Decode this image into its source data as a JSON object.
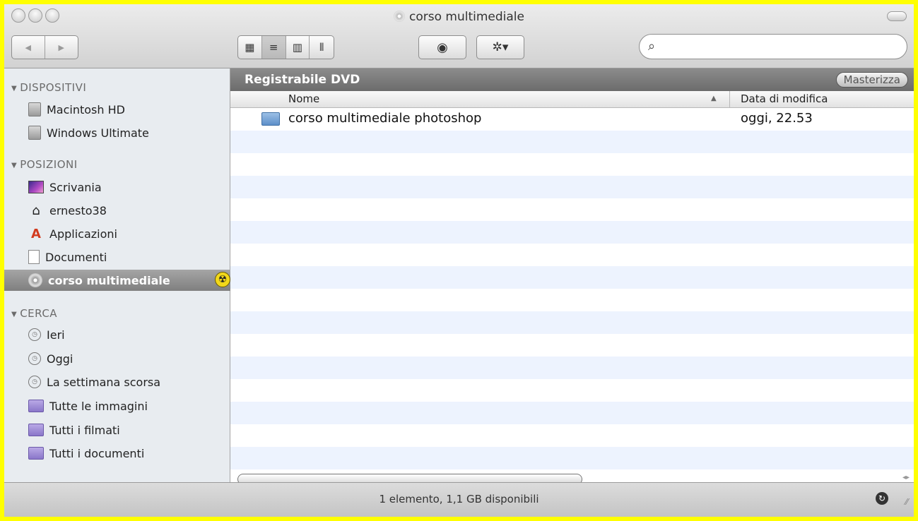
{
  "window": {
    "title": "corso multimediale"
  },
  "toolbar": {
    "back_icon": "◀",
    "forward_icon": "▶",
    "view_icons": [
      "▦",
      "≡",
      "▥",
      "⦀"
    ],
    "quicklook_icon": "◉",
    "action_icon": "✲▾",
    "search": {
      "placeholder": "",
      "icon": "⌕"
    }
  },
  "sidebar": {
    "sections": [
      {
        "label": "DISPOSITIVI",
        "items": [
          {
            "label": "Macintosh HD",
            "icon": "hard-disk-icon"
          },
          {
            "label": "Windows Ultimate",
            "icon": "hard-disk-icon"
          }
        ]
      },
      {
        "label": "POSIZIONI",
        "items": [
          {
            "label": "Scrivania",
            "icon": "desktop-icon"
          },
          {
            "label": "ernesto38",
            "icon": "home-icon"
          },
          {
            "label": "Applicazioni",
            "icon": "applications-icon"
          },
          {
            "label": "Documenti",
            "icon": "documents-icon"
          },
          {
            "label": "corso multimediale",
            "icon": "cd-icon",
            "selected": true
          }
        ]
      },
      {
        "label": "CERCA",
        "items": [
          {
            "label": "Ieri",
            "icon": "clock-icon"
          },
          {
            "label": "Oggi",
            "icon": "clock-icon"
          },
          {
            "label": "La settimana scorsa",
            "icon": "clock-icon"
          },
          {
            "label": "Tutte le immagini",
            "icon": "smart-folder-icon"
          },
          {
            "label": "Tutti i filmati",
            "icon": "smart-folder-icon"
          },
          {
            "label": "Tutti i documenti",
            "icon": "smart-folder-icon"
          }
        ]
      }
    ]
  },
  "main": {
    "header_title": "Registrabile DVD",
    "burn_button": "Masterizza",
    "columns": {
      "name": "Nome",
      "date": "Data di modifica"
    },
    "files": [
      {
        "name": "corso multimediale photoshop",
        "date": "oggi, 22.53"
      }
    ]
  },
  "statusbar": {
    "text": "1 elemento, 1,1 GB disponibili"
  }
}
